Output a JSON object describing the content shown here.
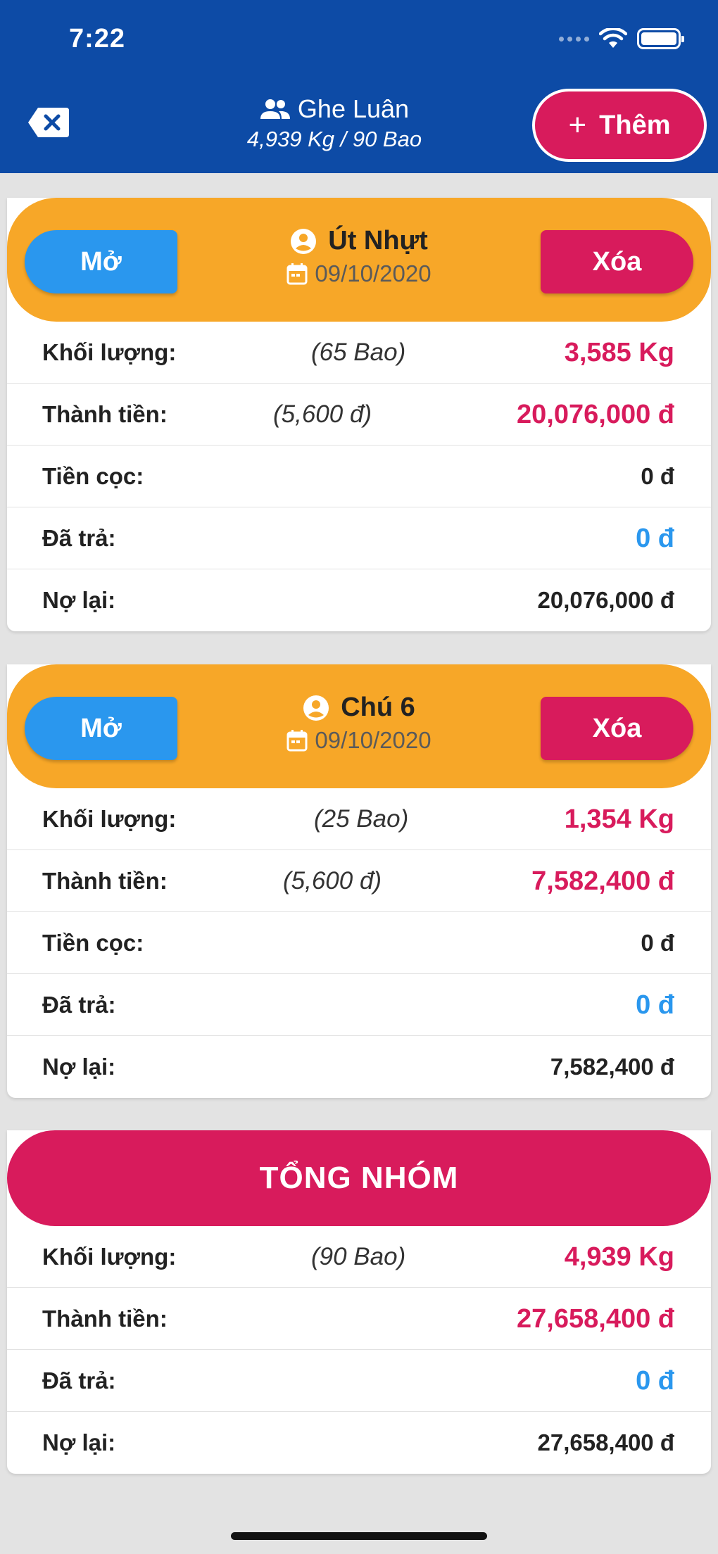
{
  "status": {
    "time": "7:22"
  },
  "header": {
    "title": "Ghe Luân",
    "subtitle": "4,939 Kg / 90 Bao",
    "add_label": "Thêm"
  },
  "colors": {
    "header": "#0d4ba6",
    "accent_pink": "#d81b5c",
    "card_orange": "#f7a728",
    "blue": "#2a97ee"
  },
  "cards": [
    {
      "name": "Út Nhựt",
      "date": "09/10/2020",
      "open_label": "Mở",
      "delete_label": "Xóa",
      "rows": {
        "weight_label": "Khối lượng:",
        "weight_mid": "(65 Bao)",
        "weight_val": "3,585 Kg",
        "amount_label": "Thành tiền:",
        "amount_mid": "(5,600 đ)",
        "amount_val": "20,076,000 đ",
        "deposit_label": "Tiền cọc:",
        "deposit_val": "0 đ",
        "paid_label": "Đã trả:",
        "paid_val": "0 đ",
        "debt_label": "Nợ lại:",
        "debt_val": "20,076,000  đ"
      }
    },
    {
      "name": "Chú 6",
      "date": "09/10/2020",
      "open_label": "Mở",
      "delete_label": "Xóa",
      "rows": {
        "weight_label": "Khối lượng:",
        "weight_mid": "(25 Bao)",
        "weight_val": "1,354 Kg",
        "amount_label": "Thành tiền:",
        "amount_mid": "(5,600 đ)",
        "amount_val": "7,582,400 đ",
        "deposit_label": "Tiền cọc:",
        "deposit_val": "0 đ",
        "paid_label": "Đã trả:",
        "paid_val": "0 đ",
        "debt_label": "Nợ lại:",
        "debt_val": "7,582,400  đ"
      }
    }
  ],
  "total": {
    "title": "TỔNG NHÓM",
    "weight_label": "Khối lượng:",
    "weight_mid": "(90 Bao)",
    "weight_val": "4,939 Kg",
    "amount_label": "Thành tiền:",
    "amount_val": "27,658,400 đ",
    "paid_label": "Đã trả:",
    "paid_val": "0 đ",
    "debt_label": "Nợ lại:",
    "debt_val": "27,658,400  đ"
  }
}
